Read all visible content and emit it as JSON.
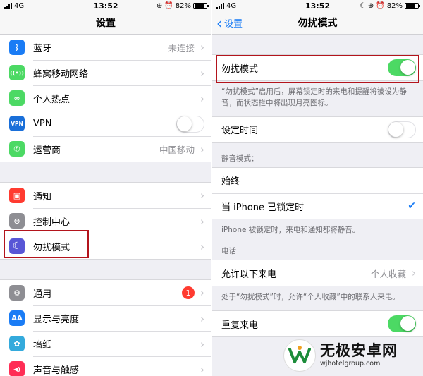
{
  "left": {
    "status": {
      "carrier": "4G",
      "time": "13:52",
      "battery": "82%",
      "battery_level": 0.82
    },
    "nav_title": "设置",
    "group1": [
      {
        "label": "蓝牙",
        "value": "未连接",
        "icon": "bluetooth-icon",
        "color": "#1a7cf5"
      },
      {
        "label": "蜂窝移动网络",
        "value": "",
        "icon": "cellular-antenna-icon",
        "color": "#4cd964"
      },
      {
        "label": "个人热点",
        "value": "",
        "icon": "hotspot-link-icon",
        "color": "#4cd964"
      },
      {
        "label": "VPN",
        "value": "",
        "icon": "vpn-icon",
        "icon_text": "VPN",
        "color": "#1a6fd9",
        "toggle": false
      },
      {
        "label": "运营商",
        "value": "中国移动",
        "icon": "phone-icon",
        "color": "#4cd964"
      }
    ],
    "group2": [
      {
        "label": "通知",
        "icon": "notification-icon",
        "color": "#ff3b30"
      },
      {
        "label": "控制中心",
        "icon": "control-center-icon",
        "color": "#8e8e93"
      },
      {
        "label": "勿扰模式",
        "icon": "moon-icon",
        "color": "#5856d6"
      }
    ],
    "group3": [
      {
        "label": "通用",
        "icon": "gear-icon",
        "color": "#8e8e93",
        "badge": "1"
      },
      {
        "label": "显示与亮度",
        "icon": "text-size-icon",
        "icon_text": "AA",
        "color": "#1a7cf5"
      },
      {
        "label": "墙纸",
        "icon": "wallpaper-flower-icon",
        "color": "#34aadc"
      },
      {
        "label": "声音与触感",
        "icon": "speaker-icon",
        "color": "#ff2d55"
      }
    ]
  },
  "right": {
    "status": {
      "carrier": "4G",
      "time": "13:52",
      "battery": "82%",
      "battery_level": 0.82
    },
    "back_label": "设置",
    "nav_title": "勿扰模式",
    "dnd_label": "勿扰模式",
    "dnd_on": true,
    "dnd_note": "“勿扰模式”启用后，屏幕锁定时的来电和提醒将被设为静音，而状态栏中将出现月亮图标。",
    "schedule_label": "设定时间",
    "schedule_on": false,
    "silence_header": "静音模式：",
    "always_label": "始终",
    "locked_label": "当 iPhone 已锁定时",
    "locked_note": "iPhone 被锁定时，来电和通知都将静音。",
    "phone_header": "电话",
    "allow_calls_label": "允许以下来电",
    "allow_calls_value": "个人收藏",
    "allow_note": "处于“勿扰模式”时，允许“个人收藏”中的联系人来电。",
    "repeat_label": "重复来电",
    "repeat_on": true
  },
  "watermark": {
    "name": "无极安卓网",
    "url": "wjhotelgroup.com"
  },
  "accent_color": "#1a7cf5",
  "highlight_color": "#b3141c"
}
